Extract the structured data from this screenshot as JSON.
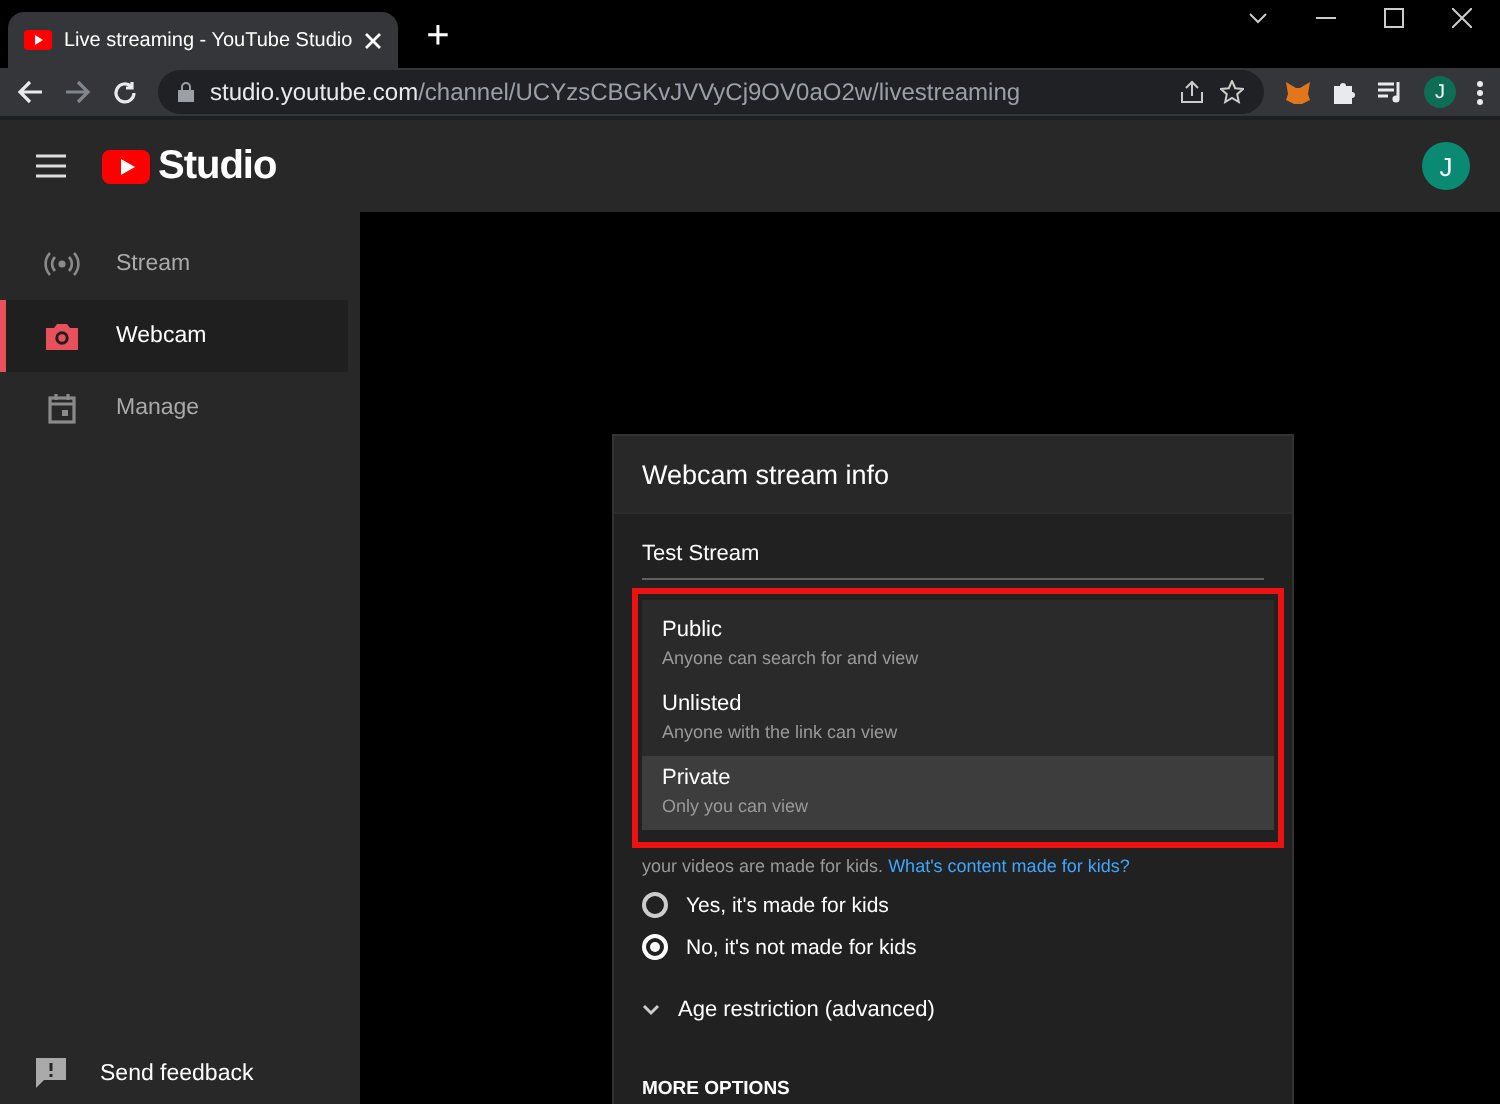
{
  "browser": {
    "tab_title": "Live streaming - YouTube Studio",
    "new_tab": "+",
    "url_host": "studio.youtube.com",
    "url_path": "/channel/UCYzsCBGKvJVVyCj9OV0aO2w/livestreaming",
    "profile_initial": "J"
  },
  "header": {
    "logo_text": "Studio",
    "avatar_initial": "J"
  },
  "sidebar": {
    "items": [
      {
        "label": "Stream",
        "kind": "broadcast",
        "selected": false
      },
      {
        "label": "Webcam",
        "kind": "camera",
        "selected": true
      },
      {
        "label": "Manage",
        "kind": "calendar",
        "selected": false
      }
    ],
    "footer": {
      "label": "Send feedback"
    }
  },
  "dialog": {
    "title": "Webcam stream info",
    "stream_title": "Test Stream",
    "visibility_options": [
      {
        "label": "Public",
        "description": "Anyone can search for and view",
        "selected": false
      },
      {
        "label": "Unlisted",
        "description": "Anyone with the link can view",
        "selected": false
      },
      {
        "label": "Private",
        "description": "Only you can view",
        "selected": true
      }
    ],
    "kids_note": "your videos are made for kids.",
    "kids_link": "What's content made for kids?",
    "audience": [
      {
        "label": "Yes, it's made for kids",
        "selected": false
      },
      {
        "label": "No, it's not made for kids",
        "selected": true
      }
    ],
    "age_restriction": {
      "label": "Age restriction (advanced)",
      "expanded": false
    },
    "more_options": "MORE OPTIONS"
  }
}
